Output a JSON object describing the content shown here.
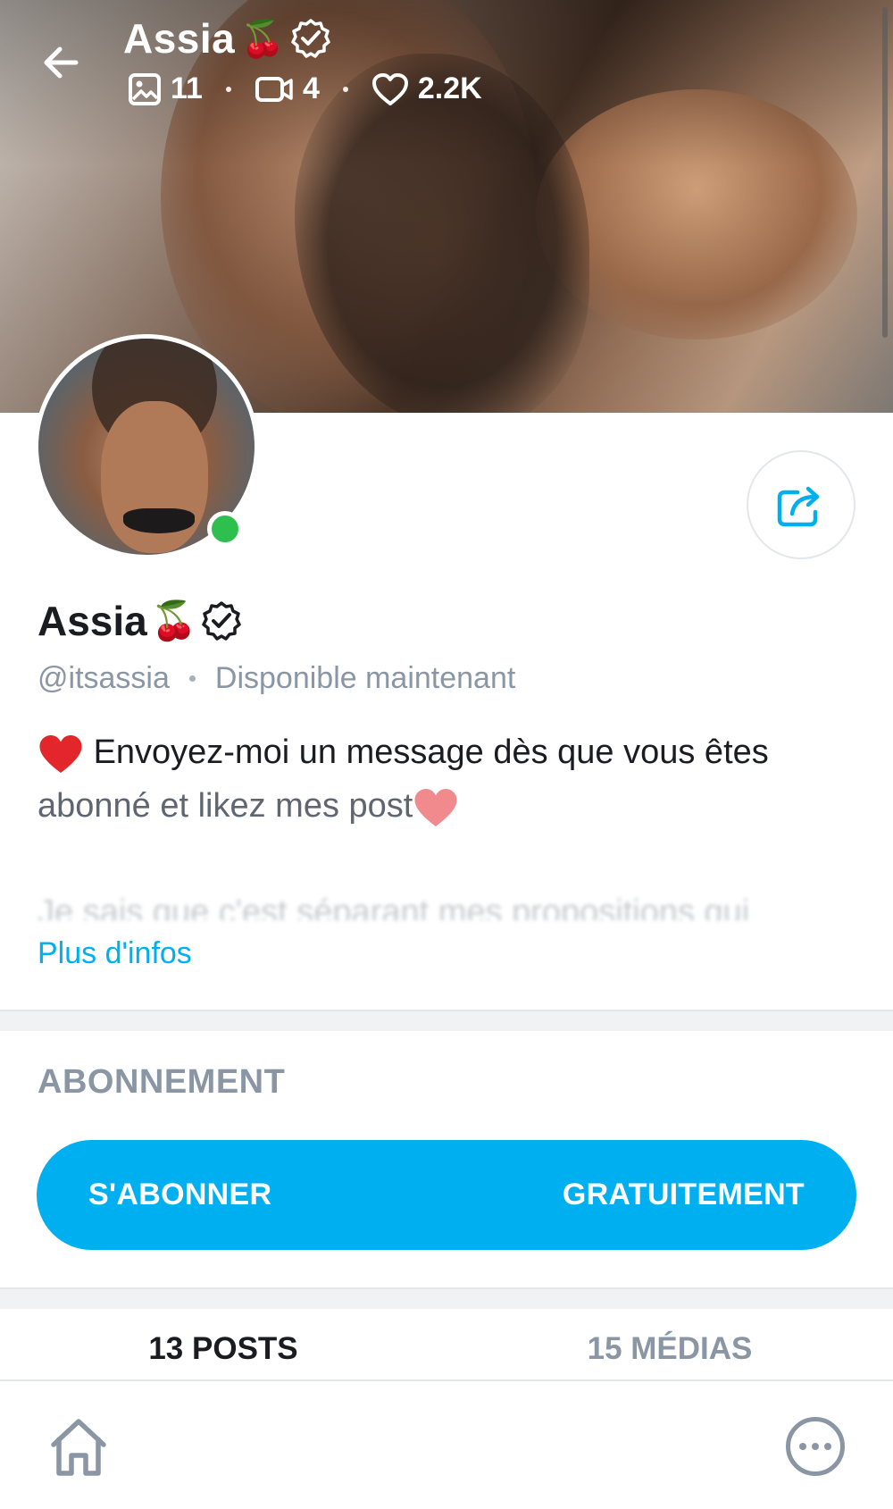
{
  "header": {
    "title": "Assia",
    "title_emoji": "🍒",
    "stats": {
      "photos": "11",
      "videos": "4",
      "likes": "2.2K"
    }
  },
  "profile": {
    "name": "Assia",
    "name_emoji": "🍒",
    "handle": "@itsassia",
    "status": "Disponible maintenant",
    "bio_line1": "Envoyez-moi un message dès que vous êtes",
    "bio_line2": "abonné et likez mes post",
    "bio_hidden": "Je sais que c'est séparant mes propositions qui",
    "more_link": "Plus d'infos",
    "online": true
  },
  "subscription": {
    "section_title": "ABONNEMENT",
    "button_left": "S'ABONNER",
    "button_right": "GRATUITEMENT"
  },
  "tabs": [
    {
      "label": "13 POSTS",
      "active": true
    },
    {
      "label": "15 MÉDIAS",
      "active": false
    }
  ],
  "colors": {
    "accent": "#00aff0",
    "online": "#2fbf4f",
    "muted": "#8a96a3"
  },
  "icons": [
    "back-arrow-icon",
    "verified-badge-icon",
    "image-icon",
    "video-icon",
    "heart-outline-icon",
    "share-icon",
    "red-heart-icon",
    "home-icon",
    "more-icon"
  ]
}
